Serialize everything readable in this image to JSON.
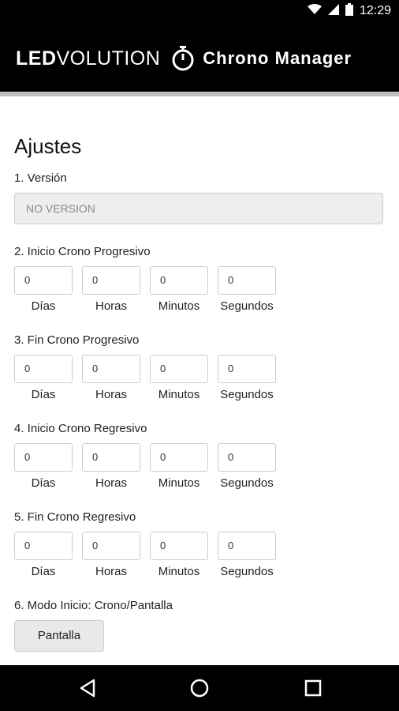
{
  "status_bar": {
    "time": "12:29",
    "icons": [
      "wifi-icon",
      "signal-icon",
      "battery-icon"
    ]
  },
  "header": {
    "brand_bold": "LED",
    "brand_light": "VOLUTION",
    "icon": "stopwatch-icon",
    "title": "Chrono Manager"
  },
  "settings": {
    "title": "Ajustes",
    "version": {
      "label": "1. Versión",
      "value": "NO VERSION"
    },
    "units": {
      "days": "Días",
      "hours": "Horas",
      "minutes": "Minutos",
      "seconds": "Segundos"
    },
    "sections": [
      {
        "label": "2. Inicio Crono Progresivo",
        "days": "0",
        "hours": "0",
        "minutes": "0",
        "seconds": "0"
      },
      {
        "label": "3. Fin Crono Progresivo",
        "days": "0",
        "hours": "0",
        "minutes": "0",
        "seconds": "0"
      },
      {
        "label": "4. Inicio Crono Regresivo",
        "days": "0",
        "hours": "0",
        "minutes": "0",
        "seconds": "0"
      },
      {
        "label": "5. Fin Crono Regresivo",
        "days": "0",
        "hours": "0",
        "minutes": "0",
        "seconds": "0"
      }
    ],
    "mode": {
      "label": "6. Modo Inicio: Crono/Pantalla",
      "button": "Pantalla"
    }
  },
  "nav_bar": {
    "icons": [
      "back-icon",
      "home-icon",
      "recents-icon"
    ]
  },
  "colors": {
    "bar_background": "#000000",
    "header_rule": "#bdbdbd",
    "disabled_field": "#eeeeee"
  }
}
